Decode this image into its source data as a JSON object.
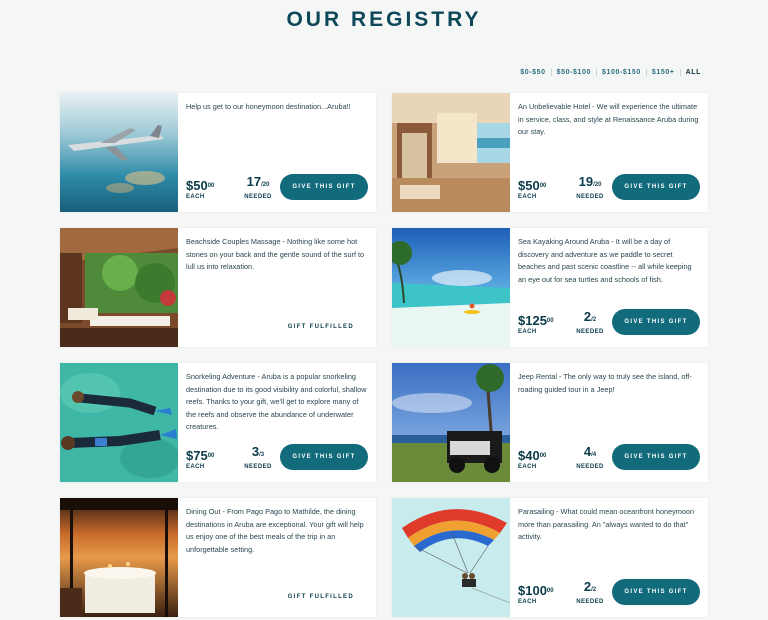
{
  "page": {
    "title": "OUR REGISTRY"
  },
  "filters": [
    {
      "label": "$0-$50",
      "active": false
    },
    {
      "label": "$50-$100",
      "active": false
    },
    {
      "label": "$100-$150",
      "active": false
    },
    {
      "label": "$150+",
      "active": false
    },
    {
      "label": "ALL",
      "active": true
    }
  ],
  "labels": {
    "each": "EACH",
    "needed": "NEEDED",
    "give": "GIVE THIS GIFT",
    "fulfilled": "GIFT FULFILLED"
  },
  "gifts": [
    {
      "desc": "Help us get to our honeymoon destination...Aruba!!",
      "price": "$50",
      "cents": "00",
      "needed": "17",
      "total": "/20",
      "image": "airplane-photo"
    },
    {
      "desc": "An Unbelievable Hotel - We will experience the ultimate in service, class, and style at Renaissance Aruba during our stay.",
      "price": "$50",
      "cents": "00",
      "needed": "19",
      "total": "/20",
      "image": "hotel-room-photo"
    },
    {
      "desc": "Beachside Couples Massage - Nothing like some hot stones on your back and the gentle sound of the surf to lull us into relaxation.",
      "image": "massage-photo"
    },
    {
      "desc": "Sea Kayaking Around Aruba - It will be a day of discovery and adventure as we paddle to secret beaches and past scenic coastline -- all while keeping an eye out for sea turtles and schools of fish.",
      "price": "$125",
      "cents": "00",
      "needed": "2",
      "total": "/2",
      "image": "kayak-photo"
    },
    {
      "desc": "Snorkeling Adventure - Aruba is a popular snorkeling destination due to its good visibility and colorful, shallow reefs. Thanks to your gift, we'll get to explore many of the reefs and observe the abundance of underwater creatures.",
      "price": "$75",
      "cents": "00",
      "needed": "3",
      "total": "/3",
      "image": "snorkel-photo"
    },
    {
      "desc": "Jeep Rental - The only way to truly see the island, off-roading guided tour in a Jeep!",
      "price": "$40",
      "cents": "00",
      "needed": "4",
      "total": "/4",
      "image": "jeep-photo"
    },
    {
      "desc": "Dining Out - From Pago Pago to Mathilde, the dining destinations in Aruba are exceptional. Your gift will help us enjoy one of the best meals of the trip in an unforgettable setting.",
      "image": "dining-photo"
    },
    {
      "desc": "Parasailing - What could mean oceanfront honeymoon more than parasailing. An \"always wanted to do that\" activity.",
      "price": "$100",
      "cents": "00",
      "needed": "2",
      "total": "/2",
      "image": "parasail-photo"
    }
  ]
}
